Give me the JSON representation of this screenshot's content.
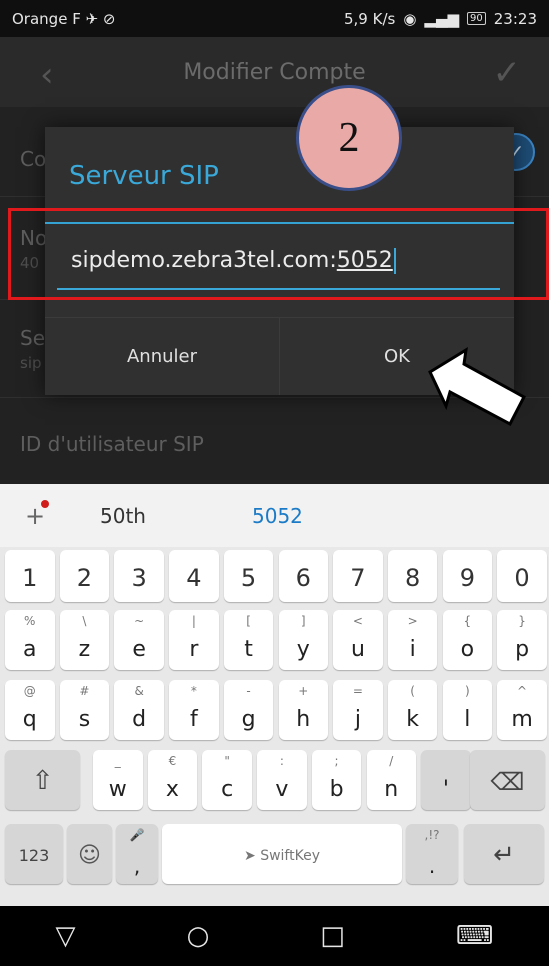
{
  "status_bar": {
    "carrier": "Orange F",
    "network_speed": "5,9 K/s",
    "battery": "90",
    "time": "23:23"
  },
  "app_bar": {
    "title": "Modifier Compte",
    "back_icon": "chevron-left-icon",
    "confirm_icon": "check-icon"
  },
  "settings": {
    "row1_title": "Co",
    "row2_title": "No",
    "row2_sub": "40",
    "row3_title": "Se",
    "row3_sub": "sip",
    "row4_title": "ID d'utilisateur SIP"
  },
  "dialog": {
    "title": "Serveur SIP",
    "input_value_prefix": "sipdemo.zebra3tel.com:",
    "input_value_port": "5052",
    "cancel_label": "Annuler",
    "ok_label": "OK"
  },
  "annotation": {
    "step_number": "2",
    "highlight_color": "#e0191c",
    "badge_color": "#e8a9a7"
  },
  "keyboard": {
    "suggestions": [
      "50th",
      "5052"
    ],
    "number_row": [
      "1",
      "2",
      "3",
      "4",
      "5",
      "6",
      "7",
      "8",
      "9",
      "0"
    ],
    "row1": [
      {
        "k": "a",
        "s": "%"
      },
      {
        "k": "z",
        "s": "\\"
      },
      {
        "k": "e",
        "s": "~"
      },
      {
        "k": "r",
        "s": "|"
      },
      {
        "k": "t",
        "s": "["
      },
      {
        "k": "y",
        "s": "]"
      },
      {
        "k": "u",
        "s": "<"
      },
      {
        "k": "i",
        "s": ">"
      },
      {
        "k": "o",
        "s": "{"
      },
      {
        "k": "p",
        "s": "}"
      }
    ],
    "row2": [
      {
        "k": "q",
        "s": "@"
      },
      {
        "k": "s",
        "s": "#"
      },
      {
        "k": "d",
        "s": "&"
      },
      {
        "k": "f",
        "s": "*"
      },
      {
        "k": "g",
        "s": "-"
      },
      {
        "k": "h",
        "s": "+"
      },
      {
        "k": "j",
        "s": "="
      },
      {
        "k": "k",
        "s": "("
      },
      {
        "k": "l",
        "s": ")"
      },
      {
        "k": "m",
        "s": "^"
      }
    ],
    "row3": [
      {
        "k": "w",
        "s": "_"
      },
      {
        "k": "x",
        "s": "€"
      },
      {
        "k": "c",
        "s": "\""
      },
      {
        "k": "v",
        "s": ":"
      },
      {
        "k": "b",
        "s": ";"
      },
      {
        "k": "n",
        "s": "/"
      },
      {
        "k": "'",
        "s": ""
      }
    ],
    "numeric_toggle": "123",
    "comma_key": ",",
    "period_key": ".",
    "period_sub": ",!?",
    "space_label": "SwiftKey"
  },
  "nav_bar": {
    "back_icon": "triangle-back-icon",
    "home_icon": "circle-home-icon",
    "recents_icon": "square-recents-icon",
    "keyboard_icon": "keyboard-icon"
  }
}
